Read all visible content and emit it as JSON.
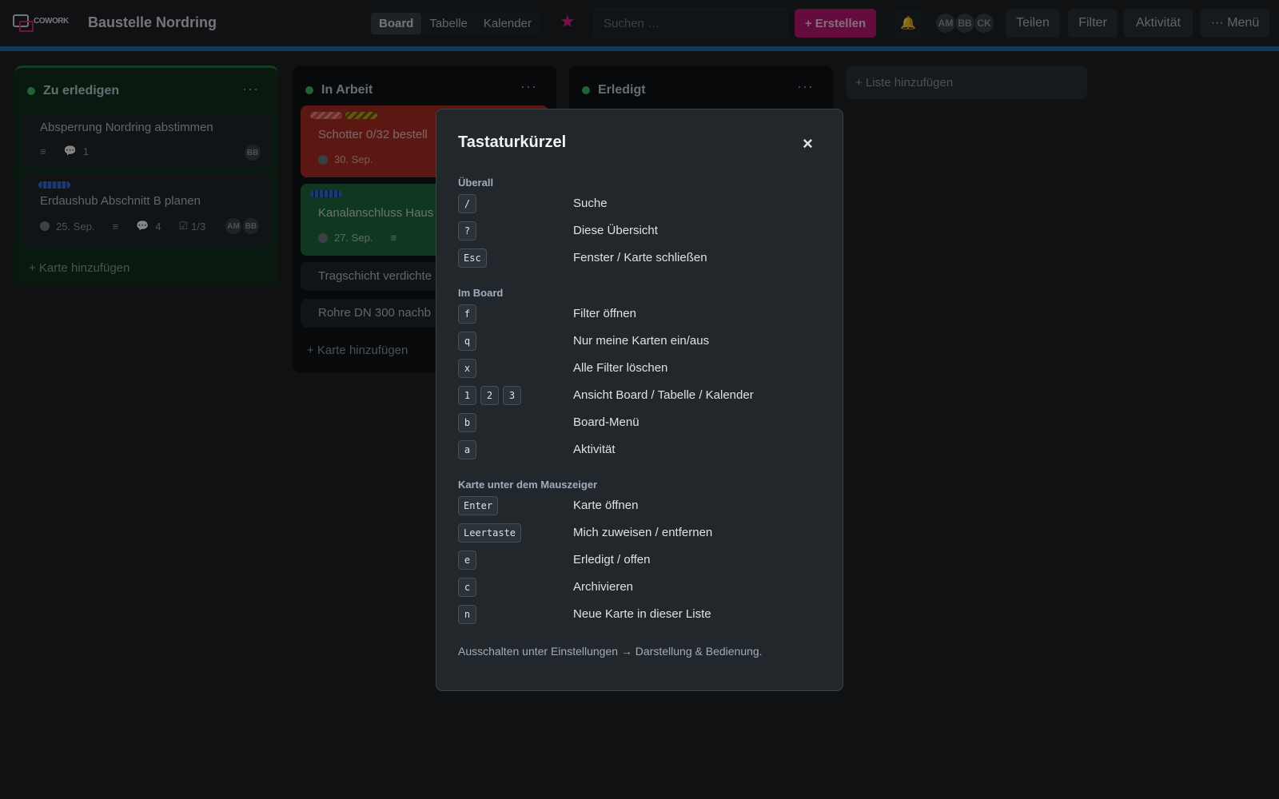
{
  "header": {
    "logo_text": "COWORK",
    "logo_text_accent": "",
    "board_title": "Baustelle Nordring",
    "views": [
      "Board",
      "Tabelle",
      "Kalender"
    ],
    "search_placeholder": "Suchen …",
    "create_label": "+ Erstellen",
    "avatars": [
      "AM",
      "BB",
      "CK"
    ],
    "share_label": "Teilen",
    "filter_label": "Filter",
    "activity_label": "Aktivität",
    "menu_label": "··· Menü",
    "accent_color": "#c2187a"
  },
  "lists": {
    "todo": {
      "title": "Zu erledigen",
      "more": "···",
      "cards": [
        {
          "title": "Absperrung Nordring abstimmen",
          "comments": "1",
          "avatars": [
            "BB"
          ]
        },
        {
          "title": "Erdaushub Abschnitt B planen",
          "date": "25. Sep.",
          "comments": "4",
          "checklist": "1/3",
          "avatars": [
            "AM",
            "BB"
          ]
        }
      ],
      "add_card": "+ Karte hinzufügen"
    },
    "inwork": {
      "title": "In Arbeit",
      "more": "···",
      "cards": [
        {
          "title": "Schotter 0/32 bestell",
          "date": "30. Sep."
        },
        {
          "title": "Kanalanschluss Haus",
          "date": "27. Sep."
        },
        {
          "title": "Tragschicht verdichte"
        },
        {
          "title": "Rohre DN 300 nachb"
        }
      ],
      "add_card": "+ Karte hinzufügen"
    },
    "done": {
      "title": "Erledigt",
      "more": "···"
    },
    "add_list": "+ Liste hinzufügen"
  },
  "modal": {
    "title": "Tastaturkürzel",
    "close": "×",
    "sections": [
      {
        "title": "Überall",
        "rows": [
          {
            "keys": [
              "/"
            ],
            "desc": "Suche"
          },
          {
            "keys": [
              "?"
            ],
            "desc": "Diese Übersicht"
          },
          {
            "keys": [
              "Esc"
            ],
            "desc": "Fenster / Karte schließen"
          }
        ]
      },
      {
        "title": "Im Board",
        "rows": [
          {
            "keys": [
              "f"
            ],
            "desc": "Filter öffnen"
          },
          {
            "keys": [
              "q"
            ],
            "desc": "Nur meine Karten ein/aus"
          },
          {
            "keys": [
              "x"
            ],
            "desc": "Alle Filter löschen"
          },
          {
            "keys": [
              "1",
              "2",
              "3"
            ],
            "desc": "Ansicht Board / Tabelle / Kalender"
          },
          {
            "keys": [
              "b"
            ],
            "desc": "Board-Menü"
          },
          {
            "keys": [
              "a"
            ],
            "desc": "Aktivität"
          }
        ]
      },
      {
        "title": "Karte unter dem Mauszeiger",
        "rows": [
          {
            "keys": [
              "Enter"
            ],
            "desc": "Karte öffnen"
          },
          {
            "keys": [
              "Leertaste"
            ],
            "desc": "Mich zuweisen / entfernen"
          },
          {
            "keys": [
              "e"
            ],
            "desc": "Erledigt / offen"
          },
          {
            "keys": [
              "c"
            ],
            "desc": "Archivieren"
          },
          {
            "keys": [
              "n"
            ],
            "desc": "Neue Karte in dieser Liste"
          }
        ]
      }
    ],
    "hint": "Ausschalten unter Einstellungen → Darstellung & Bedienung."
  }
}
